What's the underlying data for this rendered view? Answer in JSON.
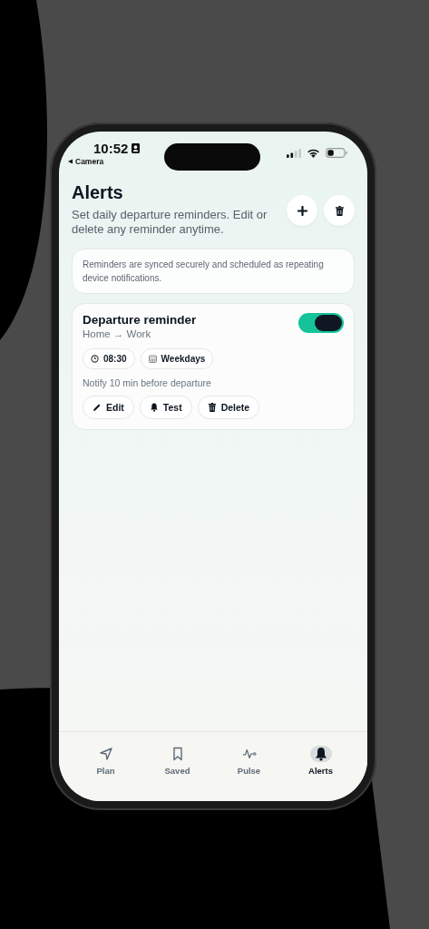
{
  "status_bar": {
    "time": "10:52",
    "back_label": "Camera"
  },
  "header": {
    "title": "Alerts",
    "subtitle": "Set daily departure reminders. Edit or delete any reminder anytime."
  },
  "notice": "Reminders are synced securely and scheduled as repeating device notifications.",
  "reminders": [
    {
      "title": "Departure reminder",
      "route": "Home → Work",
      "enabled": true,
      "time": "08:30",
      "days": "Weekdays",
      "note": "Notify 10 min before departure",
      "actions": [
        "Edit",
        "Test",
        "Delete"
      ]
    }
  ],
  "tabs": [
    {
      "label": "Plan",
      "selected": false
    },
    {
      "label": "Saved",
      "selected": false
    },
    {
      "label": "Pulse",
      "selected": false
    },
    {
      "label": "Alerts",
      "selected": true
    }
  ]
}
